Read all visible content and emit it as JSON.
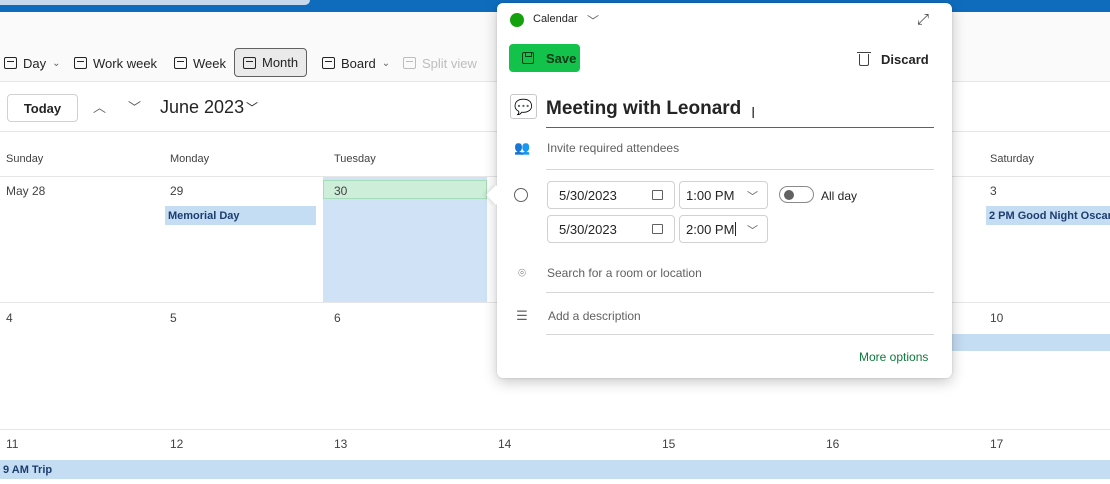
{
  "toolbar": {
    "views": [
      {
        "label": "Day",
        "has_menu": true
      },
      {
        "label": "Work week",
        "has_menu": false
      },
      {
        "label": "Week",
        "has_menu": false
      },
      {
        "label": "Month",
        "has_menu": false,
        "active": true
      },
      {
        "label": "Board",
        "has_menu": true
      },
      {
        "label": "Split view",
        "has_menu": false,
        "disabled": true
      }
    ]
  },
  "nav": {
    "today_label": "Today",
    "month_label": "June 2023"
  },
  "calendar": {
    "weekdays": [
      "Sunday",
      "Monday",
      "Tuesday",
      "",
      "",
      "",
      "Saturday"
    ],
    "weeks": [
      [
        "May 28",
        "29",
        "30",
        "",
        "",
        "",
        "3"
      ],
      [
        "4",
        "5",
        "6",
        "",
        "",
        "",
        "10"
      ],
      [
        "11",
        "12",
        "13",
        "14",
        "15",
        "16",
        "17"
      ]
    ],
    "events": [
      {
        "week": 0,
        "day": 1,
        "label": "Memorial Day"
      },
      {
        "week": 0,
        "day": 6,
        "label": "2 PM  Good Night Oscar"
      },
      {
        "week": 2,
        "day": 0,
        "label": "9 AM  Trip"
      }
    ],
    "selected_day": {
      "week": 0,
      "day": 2
    }
  },
  "dialog": {
    "calendar_name": "Calendar",
    "calendar_color": "#13a10e",
    "save_label": "Save",
    "discard_label": "Discard",
    "title_value": "Meeting with Leonard",
    "attendees_placeholder": "Invite required attendees",
    "start_date": "5/30/2023",
    "start_time": "1:00 PM",
    "end_date": "5/30/2023",
    "end_time": "2:00 PM",
    "all_day_label": "All day",
    "all_day_on": false,
    "location_placeholder": "Search for a room or location",
    "description_placeholder": "Add a description",
    "more_options_label": "More options"
  },
  "colors": {
    "accent": "#0f6cbd",
    "save_button": "#13c24a",
    "event_fill": "#c5ddf3",
    "selected_day": "#cfe2f6",
    "today_strip": "#cdeed8"
  }
}
